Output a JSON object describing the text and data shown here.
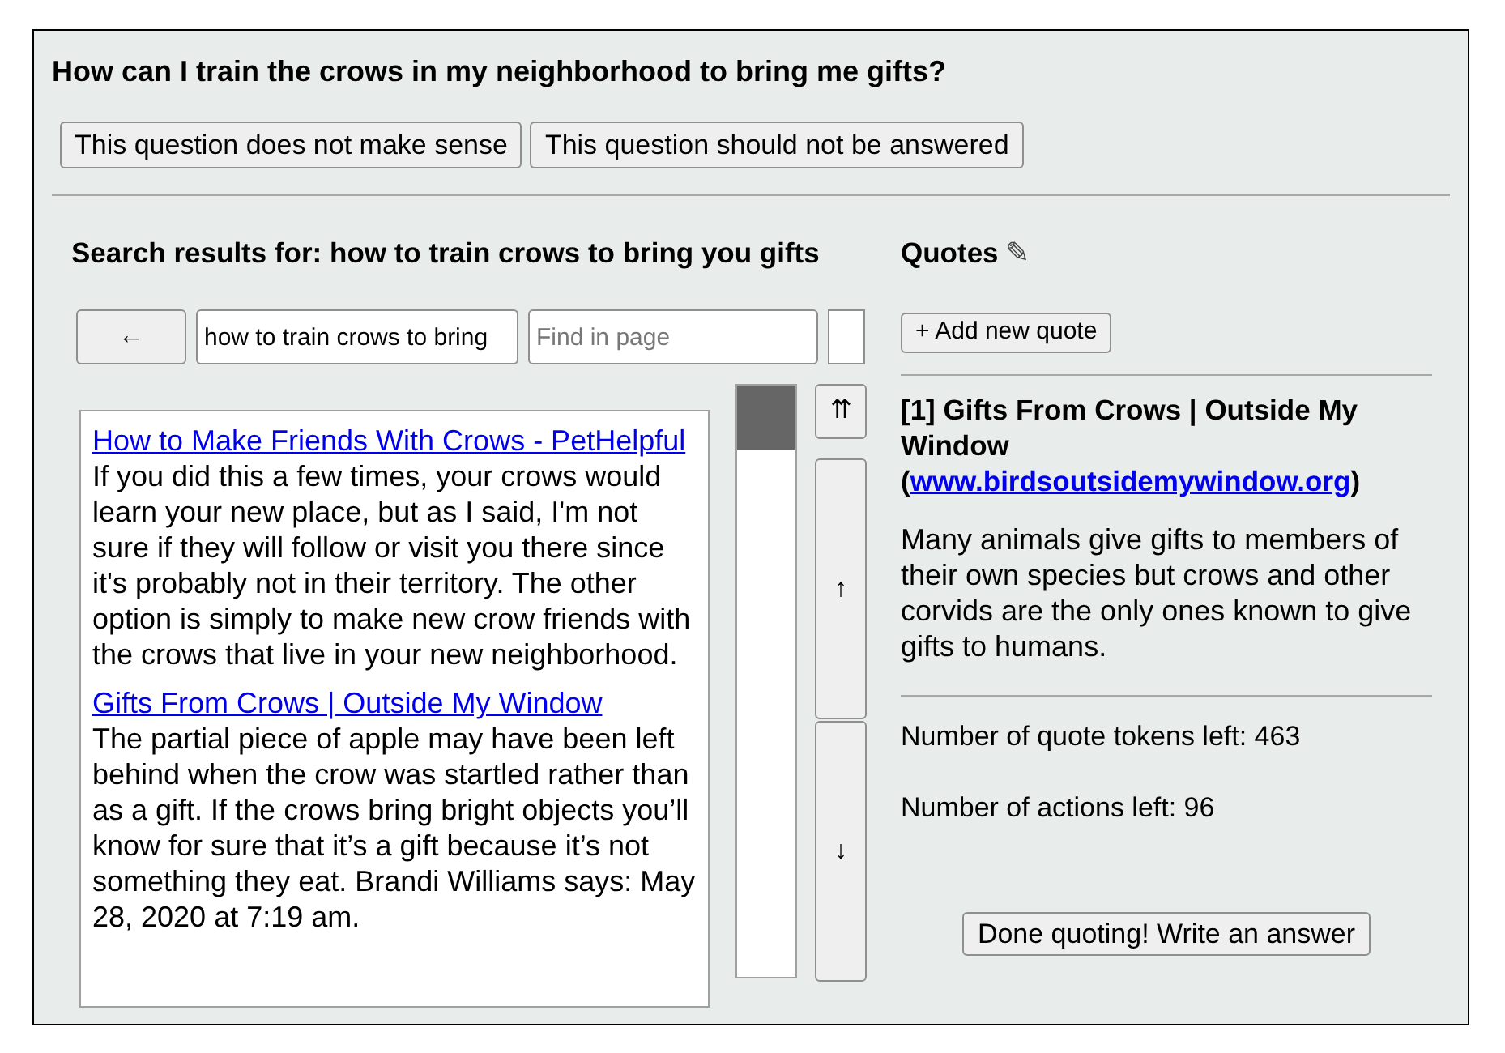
{
  "question": "How can I train the crows in my neighborhood to bring me gifts?",
  "flag_buttons": [
    "This question does not make sense",
    "This question should not be answered"
  ],
  "search": {
    "heading": "Search results for: how to train crows to bring you gifts",
    "back_button": "←",
    "query": "how to train crows to bring",
    "find_placeholder": "Find in page",
    "results": [
      {
        "title": "How to Make Friends With Crows - PetHelpful",
        "snippet": "If you did this a few times, your crows would learn your new place, but as I said, I'm not sure if they will follow or visit you there since it's probably not in their territory. The other option is simply to make new crow friends with the crows that live in your new neighborhood."
      },
      {
        "title": "Gifts From Crows | Outside My Window",
        "snippet": "The partial piece of apple may have been left behind when the crow was startled rather than as a gift. If the crows bring bright objects you’ll know for sure that it’s a gift because it’s not something they eat. Brandi Williams says: May 28, 2020 at 7:19 am."
      }
    ],
    "scroll_buttons": [
      "⇈",
      "↑",
      "↓"
    ]
  },
  "quotes": {
    "heading": "Quotes",
    "edit_icon": "✎",
    "add_button": "+ Add new quote",
    "items": [
      {
        "title": "[1] Gifts From Crows | Outside My Window (",
        "link": "www.birdsoutsidemywindow.org",
        "title_end": ")",
        "text": "Many animals give gifts to members of their own species but crows and other corvids are the only ones known to give gifts to humans."
      }
    ],
    "tokens_left": "Number of quote tokens left: 463",
    "actions_left": "Number of actions left: 96",
    "done_button": "Done quoting! Write an answer"
  }
}
